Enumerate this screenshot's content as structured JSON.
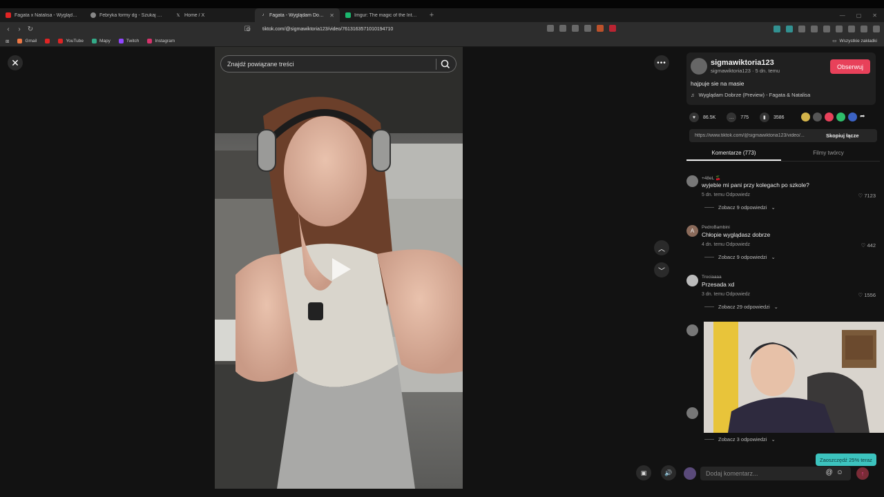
{
  "browser": {
    "tabs": [
      {
        "title": "Fagata x Natalisa - Wyglądam Dobrze",
        "color": "#e02424",
        "active": false
      },
      {
        "title": "Febryka formy dg - Szukaj w Google",
        "color": "#888888",
        "active": false
      },
      {
        "title": "Home / X",
        "color": "#111111",
        "active": false
      },
      {
        "title": "Fagata - Wyglądam Dobrze (Pre...",
        "color": "#111111",
        "active": true
      },
      {
        "title": "Imgur: The magic of the Internet",
        "color": "#1bb76e",
        "active": false
      }
    ],
    "new_tab_label": "+",
    "url": "tiktok.com/@sigmawiktoria123/video/7613163571010194710",
    "bookmarks": [
      "Gmail",
      "YouTube",
      "Mapy",
      "Twitch",
      "Instagram"
    ],
    "all_bookmarks_label": "Wszystkie zakładki"
  },
  "video": {
    "search_placeholder": "Znajdź powiązane treści"
  },
  "author": {
    "username": "sigmawiktoria123",
    "subline": "sigmawiktoria123 · 5 dn. temu",
    "follow_label": "Obserwuj",
    "description": "hajpuje sie na masie",
    "music": "Wyglądam Dobrze (Preview) - Fagata & Natalisa"
  },
  "stats": {
    "likes": "86.5K",
    "comments": "775",
    "saves": "3586"
  },
  "share_colors": [
    "#d4b44a",
    "#555555",
    "#e8415a",
    "#2ebd6b",
    "#3b62c4"
  ],
  "link": {
    "url": "https://www.tiktok.com/@sigmawiktoria123/video/...",
    "copy_label": "Skopiuj łącze"
  },
  "panel_tabs": [
    {
      "label": "Komentarze (773)",
      "active": true
    },
    {
      "label": "Filmy twórcy",
      "active": false
    }
  ],
  "comments": [
    {
      "user": "+48eL 🍒",
      "avatar": "",
      "text": "wyjebie mi pani przy kolegach po szkole?",
      "time": "5 dn. temu",
      "reply": "Odpowiedz",
      "likes": "7123",
      "replies": "Zobacz 9 odpowiedzi"
    },
    {
      "user": "PedroBambini",
      "avatar": "A",
      "text": "Chłopie wyglądasz dobrze",
      "time": "4 dn. temu",
      "reply": "Odpowiedz",
      "likes": "442",
      "replies": "Zobacz 9 odpowiedzi"
    },
    {
      "user": "Trociaaaa",
      "avatar": "",
      "text": "Przesada xd",
      "time": "3 dn. temu",
      "reply": "Odpowiedz",
      "likes": "1556",
      "replies": "Zobacz 29 odpowiedzi"
    }
  ],
  "more_replies": "Zobacz 3 odpowiedzi",
  "promo_badge": "Zaoszczędź 25% teraz",
  "comment_input_placeholder": "Dodaj komentarz..."
}
